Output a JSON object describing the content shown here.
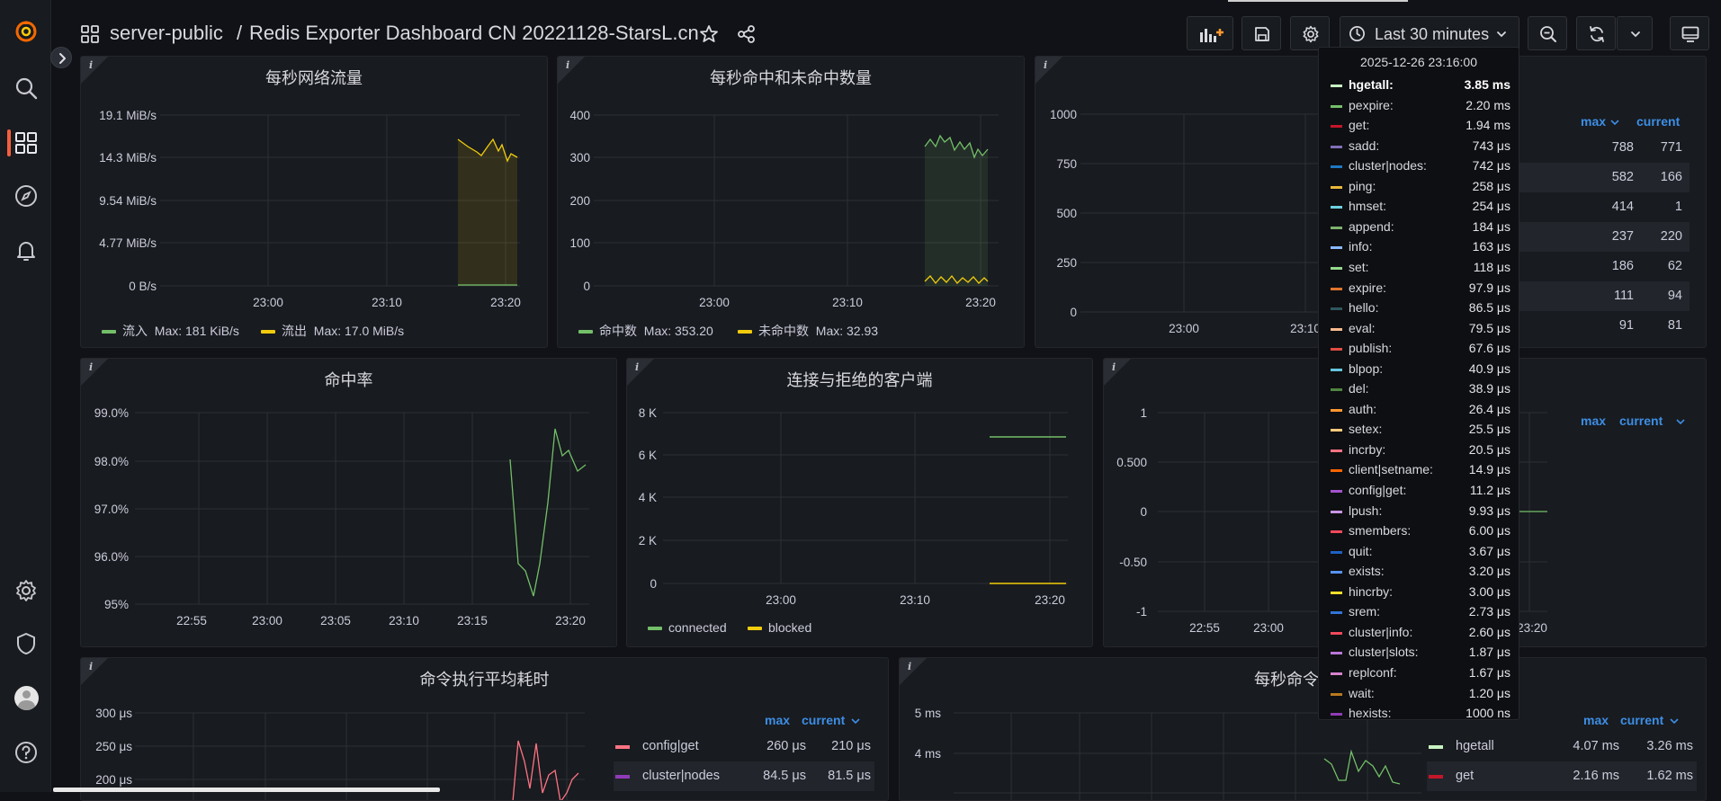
{
  "breadcrumb": {
    "folder": "server-public",
    "separator": "/",
    "dashboard": "Redis Exporter Dashboard CN 20221128-StarsL.cn"
  },
  "toolbar": {
    "time_range": "Last 30 minutes"
  },
  "sidebar": {
    "icons": [
      "grafana-logo-icon",
      "search-icon",
      "dashboards-icon",
      "explore-icon",
      "alerting-icon",
      "settings-icon",
      "shield-icon",
      "avatar",
      "help-icon"
    ]
  },
  "panels": {
    "network": {
      "title": "每秒网络流量",
      "info": "i",
      "yticks": [
        "19.1 MiB/s",
        "14.3 MiB/s",
        "9.54 MiB/s",
        "4.77 MiB/s",
        "0 B/s"
      ],
      "xticks": [
        "23:00",
        "23:10",
        "23:20"
      ],
      "legend": [
        {
          "label": "流入",
          "stat": "Max: 181 KiB/s",
          "color": "#73bf69"
        },
        {
          "label": "流出",
          "stat": "Max: 17.0 MiB/s",
          "color": "#f2cc0c"
        }
      ]
    },
    "hits": {
      "title": "每秒命中和未命中数量",
      "info": "i",
      "yticks": [
        "400",
        "300",
        "200",
        "100",
        "0"
      ],
      "xticks": [
        "23:00",
        "23:10",
        "23:20"
      ],
      "legend": [
        {
          "label": "命中数",
          "stat": "Max: 353.20",
          "color": "#73bf69"
        },
        {
          "label": "未命中数",
          "stat": "Max: 32.93",
          "color": "#f2cc0c"
        }
      ]
    },
    "commands_top": {
      "info": "i",
      "yticks": [
        "1000",
        "750",
        "500",
        "250",
        "0"
      ],
      "xticks": [
        "23:00",
        "23:10"
      ],
      "legend_headers": {
        "max": "max",
        "current": "current"
      },
      "rows": [
        {
          "name": "",
          "max": "788",
          "current": "771"
        },
        {
          "name": "re",
          "max": "582",
          "current": "166"
        },
        {
          "name": "",
          "max": "414",
          "current": "1"
        },
        {
          "name": "ll",
          "max": "237",
          "current": "220"
        },
        {
          "name": "",
          "max": "186",
          "current": "62"
        },
        {
          "name": "",
          "max": "111",
          "current": "94"
        },
        {
          "name": "nd",
          "max": "91",
          "current": "81"
        }
      ]
    },
    "hit_rate": {
      "title": "命中率",
      "info": "i",
      "yticks": [
        "99.0%",
        "98.0%",
        "97.0%",
        "96.0%",
        "95%"
      ],
      "xticks": [
        "22:55",
        "23:00",
        "23:05",
        "23:10",
        "23:15",
        "23:20"
      ]
    },
    "clients": {
      "title": "连接与拒绝的客户端",
      "info": "i",
      "yticks": [
        "8 K",
        "6 K",
        "4 K",
        "2 K",
        "0"
      ],
      "xticks": [
        "23:00",
        "23:10",
        "23:20"
      ],
      "legend": [
        {
          "label": "connected",
          "color": "#73bf69"
        },
        {
          "label": "blocked",
          "color": "#f2cc0c"
        }
      ]
    },
    "mid_right": {
      "info": "i",
      "yticks": [
        "1",
        "0.500",
        "0",
        "-0.50",
        "-1"
      ],
      "xticks": [
        "22:55",
        "23:00",
        "23:20"
      ],
      "legend_headers": {
        "max": "max",
        "current": "current"
      }
    },
    "cmd_avg": {
      "title": "命令执行平均耗时",
      "info": "i",
      "yticks": [
        "300 μs",
        "250 μs",
        "200 μs"
      ],
      "legend_headers": {
        "max": "max",
        "current": "current"
      },
      "rows": [
        {
          "name": "config|get",
          "max": "260 μs",
          "current": "210 μs",
          "color": "#ff7383"
        },
        {
          "name": "cluster|nodes",
          "max": "84.5 μs",
          "current": "81.5 μs",
          "color": "#8f3bb8"
        }
      ]
    },
    "cmd_time": {
      "title": "每秒命令花费",
      "info": "i",
      "yticks": [
        "5 ms",
        "4 ms"
      ],
      "legend_headers": {
        "max": "max",
        "current": "current"
      },
      "rows": [
        {
          "name": "hgetall",
          "max": "4.07 ms",
          "current": "3.26 ms",
          "color": "#c8f2c2"
        },
        {
          "name": "get",
          "max": "2.16 ms",
          "current": "1.62 ms",
          "color": "#c4162a"
        }
      ]
    }
  },
  "tooltip": {
    "time": "2025-12-26 23:16:00",
    "rows": [
      {
        "name": "hgetall:",
        "value": "3.85 ms",
        "color": "#c8f2c2",
        "highlight": true
      },
      {
        "name": "pexpire:",
        "value": "2.20 ms",
        "color": "#73bf69"
      },
      {
        "name": "get:",
        "value": "1.94 ms",
        "color": "#c4162a"
      },
      {
        "name": "sadd:",
        "value": "743 μs",
        "color": "#806eb7"
      },
      {
        "name": "cluster|nodes:",
        "value": "742 μs",
        "color": "#1f78c1"
      },
      {
        "name": "ping:",
        "value": "258 μs",
        "color": "#eab839"
      },
      {
        "name": "hmset:",
        "value": "254 μs",
        "color": "#6ed0e0"
      },
      {
        "name": "append:",
        "value": "184 μs",
        "color": "#7eb26d"
      },
      {
        "name": "info:",
        "value": "163 μs",
        "color": "#8ab8ff"
      },
      {
        "name": "set:",
        "value": "118 μs",
        "color": "#96d98d"
      },
      {
        "name": "expire:",
        "value": "97.9 μs",
        "color": "#e0752d"
      },
      {
        "name": "hello:",
        "value": "86.5 μs",
        "color": "#2f575e"
      },
      {
        "name": "eval:",
        "value": "79.5 μs",
        "color": "#f9ba8f"
      },
      {
        "name": "publish:",
        "value": "67.6 μs",
        "color": "#e24d42"
      },
      {
        "name": "blpop:",
        "value": "40.9 μs",
        "color": "#65c5db"
      },
      {
        "name": "del:",
        "value": "38.9 μs",
        "color": "#508642"
      },
      {
        "name": "auth:",
        "value": "26.4 μs",
        "color": "#ff9830"
      },
      {
        "name": "setex:",
        "value": "25.5 μs",
        "color": "#ffcb7d"
      },
      {
        "name": "incrby:",
        "value": "20.5 μs",
        "color": "#ff7383"
      },
      {
        "name": "client|setname:",
        "value": "14.9 μs",
        "color": "#fa6400"
      },
      {
        "name": "config|get:",
        "value": "11.2 μs",
        "color": "#a352cc"
      },
      {
        "name": "lpush:",
        "value": "9.93 μs",
        "color": "#ca95e5"
      },
      {
        "name": "smembers:",
        "value": "6.00 μs",
        "color": "#f2495c"
      },
      {
        "name": "quit:",
        "value": "3.67 μs",
        "color": "#1f60c4"
      },
      {
        "name": "exists:",
        "value": "3.20 μs",
        "color": "#5794f2"
      },
      {
        "name": "hincrby:",
        "value": "3.00 μs",
        "color": "#fade2a"
      },
      {
        "name": "srem:",
        "value": "2.73 μs",
        "color": "#3274d9"
      },
      {
        "name": "cluster|info:",
        "value": "2.60 μs",
        "color": "#f2495c"
      },
      {
        "name": "cluster|slots:",
        "value": "1.87 μs",
        "color": "#b877d9"
      },
      {
        "name": "replconf:",
        "value": "1.67 μs",
        "color": "#d683ce"
      },
      {
        "name": "wait:",
        "value": "1.20 μs",
        "color": "#b7791f"
      },
      {
        "name": "hexists:",
        "value": "1000 ns",
        "color": "#8f3bb8"
      }
    ]
  }
}
